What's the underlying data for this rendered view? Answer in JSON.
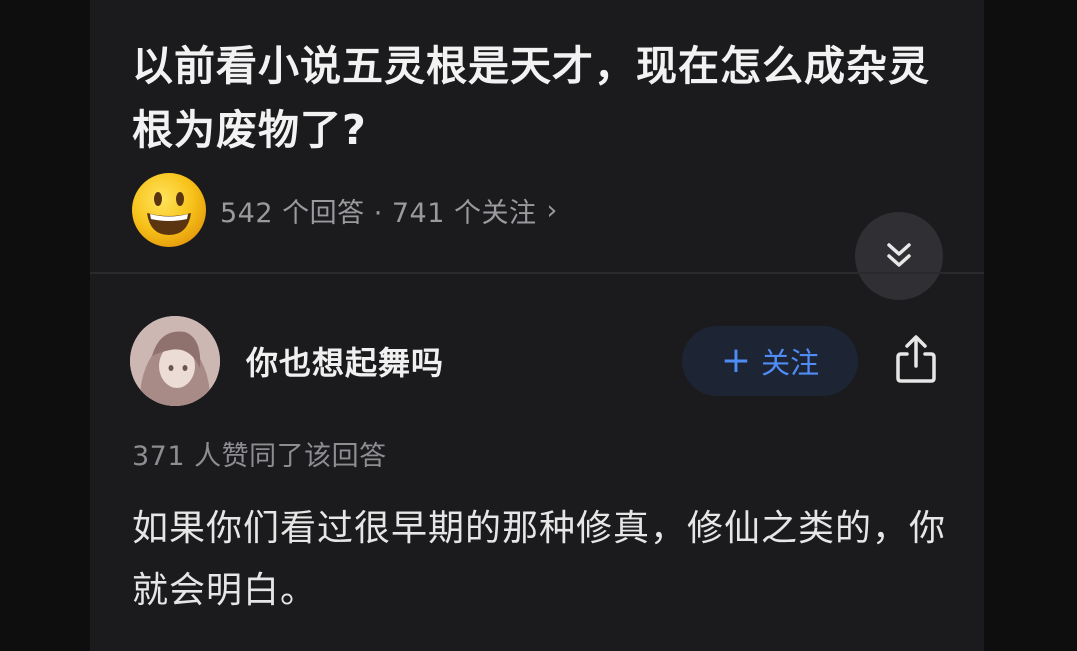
{
  "question": {
    "title": "以前看小说五灵根是天才，现在怎么成杂灵根为废物了?",
    "stats": "542 个回答 · 741 个关注",
    "chevron": "›",
    "emoji_icon": "smiley-face-icon"
  },
  "collapse_icon": "double-chevron-down-icon",
  "author": {
    "name": "你也想起舞吗",
    "follow_plus": "+",
    "follow_label": "关注",
    "share_icon": "share-icon"
  },
  "answer": {
    "upvotes": "371 人赞同了该回答",
    "body": "如果你们看过很早期的那种修真，修仙之类的，你就会明白。"
  },
  "colors": {
    "background": "#1b1b1d",
    "accent": "#4f8cf5",
    "emoji_yellow": "#f7c21a"
  }
}
